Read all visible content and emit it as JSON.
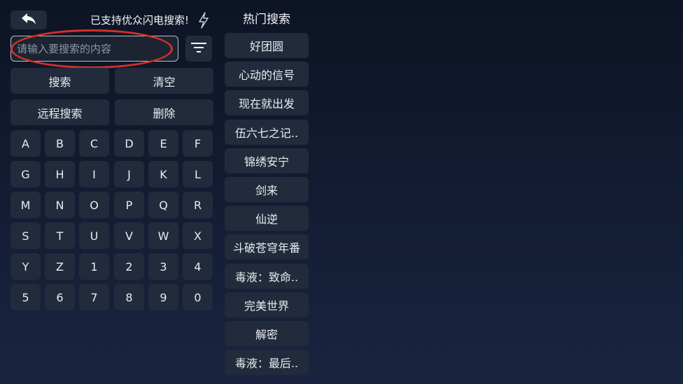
{
  "header": {
    "back_icon": "back-arrow-icon",
    "notice": "已支持优众闪电搜索!",
    "bolt_icon": "lightning-icon"
  },
  "search": {
    "placeholder": "请输入要搜索的内容",
    "value": "",
    "filter_icon": "filter-icon",
    "highlight_color": "#d3302a"
  },
  "actions": {
    "search": "搜索",
    "clear": "清空",
    "remote_search": "远程搜索",
    "delete": "删除"
  },
  "keyboard": {
    "keys": [
      "A",
      "B",
      "C",
      "D",
      "E",
      "F",
      "G",
      "H",
      "I",
      "J",
      "K",
      "L",
      "M",
      "N",
      "O",
      "P",
      "Q",
      "R",
      "S",
      "T",
      "U",
      "V",
      "W",
      "X",
      "Y",
      "Z",
      "1",
      "2",
      "3",
      "4",
      "5",
      "6",
      "7",
      "8",
      "9",
      "0"
    ]
  },
  "hot_search": {
    "title": "热门搜索",
    "items": [
      "好团圆",
      "心动的信号",
      "现在就出发",
      "伍六七之记..",
      "锦绣安宁",
      "剑来",
      "仙逆",
      "斗破苍穹年番",
      "毒液：致命..",
      "完美世界",
      "解密",
      "毒液：最后.."
    ]
  },
  "colors": {
    "button_bg": "#222b3b",
    "background_top": "#0d1424",
    "background_bottom": "#1a2440"
  }
}
